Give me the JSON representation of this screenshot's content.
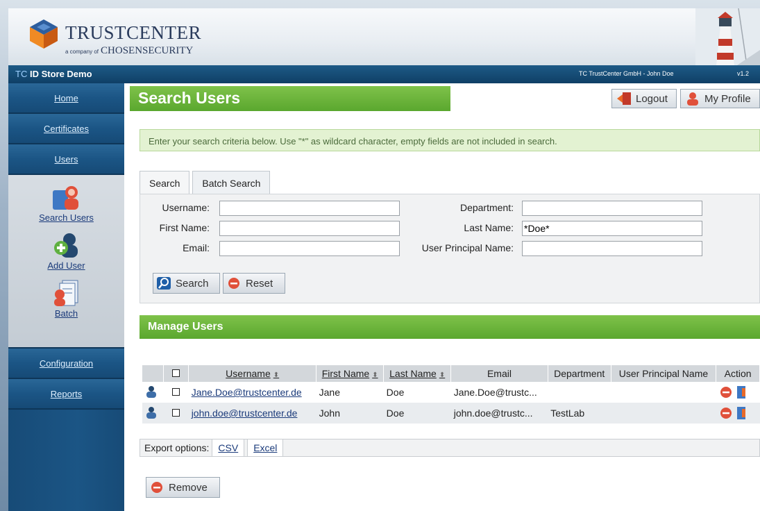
{
  "header": {
    "logo_main": "TRUSTCENTER",
    "logo_company_prefix": "a company of",
    "logo_company": "CHOSENSECURITY"
  },
  "topbar": {
    "tc": "TC",
    "app_title": "ID Store Demo",
    "company_user": "TC TrustCenter GmbH - John Doe",
    "version": "v1.2"
  },
  "sidebar": {
    "items": [
      {
        "label": "Home"
      },
      {
        "label": "Certificates"
      },
      {
        "label": "Users"
      },
      {
        "label": "Configuration"
      },
      {
        "label": "Reports"
      }
    ],
    "tools": [
      {
        "label": "Search Users",
        "icon": "search-users-icon"
      },
      {
        "label": "Add User",
        "icon": "add-user-icon"
      },
      {
        "label": "Batch",
        "icon": "batch-icon"
      }
    ]
  },
  "page": {
    "title": "Search Users",
    "logout_label": "Logout",
    "profile_label": "My Profile",
    "info": "Enter your search criteria below. Use \"*\" as wildcard character, empty fields are not included in search."
  },
  "tabs": [
    {
      "label": "Search",
      "active": true
    },
    {
      "label": "Batch Search",
      "active": false
    }
  ],
  "search": {
    "username_label": "Username:",
    "username_value": "",
    "firstname_label": "First Name:",
    "firstname_value": "",
    "email_label": "Email:",
    "email_value": "",
    "department_label": "Department:",
    "department_value": "",
    "lastname_label": "Last Name:",
    "lastname_value": "*Doe*",
    "upn_label": "User Principal Name:",
    "upn_value": "",
    "search_button": "Search",
    "reset_button": "Reset"
  },
  "manage": {
    "title": "Manage Users",
    "columns": [
      "Username",
      "First Name",
      "Last Name",
      "Email",
      "Department",
      "User Principal Name",
      "Action"
    ],
    "rows": [
      {
        "username": "Jane.Doe@trustcenter.de",
        "first": "Jane",
        "last": "Doe",
        "email": "Jane.Doe@trustc...",
        "department": "",
        "upn": ""
      },
      {
        "username": "john.doe@trustcenter.de",
        "first": "John",
        "last": "Doe",
        "email": "john.doe@trustc...",
        "department": "TestLab",
        "upn": ""
      }
    ]
  },
  "export": {
    "label": "Export options:",
    "csv": "CSV",
    "excel": "Excel"
  },
  "remove_button": "Remove",
  "colors": {
    "accent_green": "#5aa72e",
    "nav_blue": "#1b5585",
    "link_blue": "#1a3a7a"
  }
}
